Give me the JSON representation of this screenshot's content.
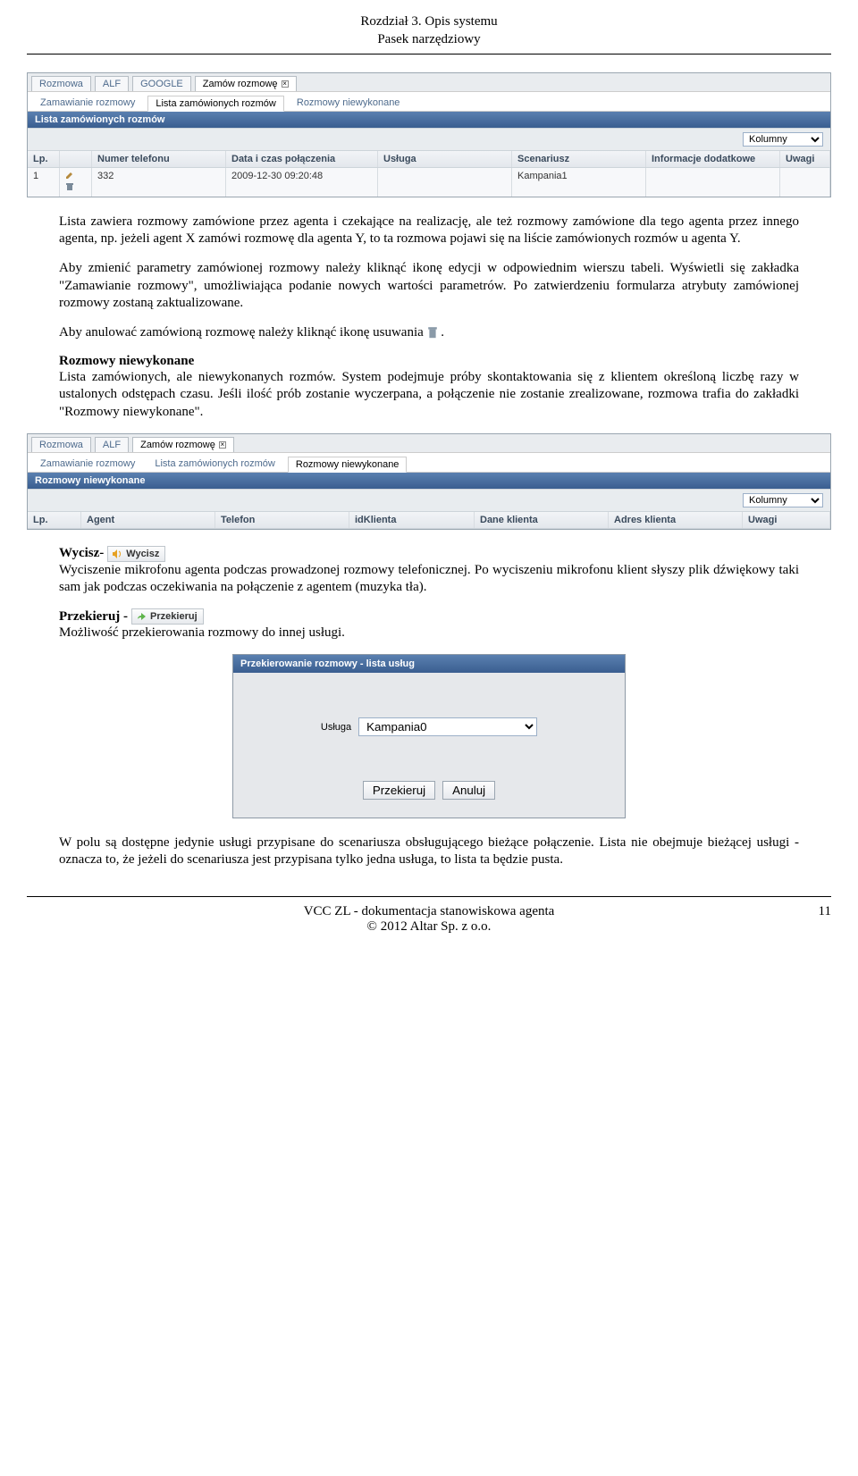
{
  "header": {
    "line1": "Rozdział 3. Opis systemu",
    "line2": "Pasek narzędziowy"
  },
  "shot1": {
    "tabs": [
      "Rozmowa",
      "ALF",
      "GOOGLE",
      "Zamów rozmowę"
    ],
    "subtabs": [
      "Zamawianie rozmowy",
      "Lista zamówionych rozmów",
      "Rozmowy niewykonane"
    ],
    "panel": "Lista zamówionych rozmów",
    "kolumny": "Kolumny",
    "cols": [
      "Lp.",
      "Numer telefonu",
      "Data i czas połączenia",
      "Usługa",
      "Scenariusz",
      "Informacje dodatkowe",
      "Uwagi"
    ],
    "row": {
      "lp": "1",
      "num": "332",
      "date": "2009-12-30 09:20:48",
      "scen": "Kampania1"
    }
  },
  "p1": "Lista zawiera rozmowy zamówione przez agenta i czekające na realizację, ale też rozmowy zamówione dla tego agenta przez innego agenta, np. jeżeli agent X zamówi rozmowę dla agenta Y, to ta rozmowa pojawi się na liście zamówionych rozmów u agenta Y.",
  "p2": "Aby zmienić parametry zamówionej rozmowy należy kliknąć ikonę edycji w odpowiednim wierszu tabeli. Wyświetli się zakładka \"Zamawianie rozmowy\", umożliwiająca podanie nowych wartości parametrów. Po zatwierdzeniu formularza atrybuty zamówionej rozmowy zostaną zaktualizowane.",
  "p3a": "Aby anulować zamówioną rozmowę należy kliknąć ikonę usuwania ",
  "p3b": " .",
  "rozmowy_h": "Rozmowy niewykonane",
  "p4": "Lista zamówionych, ale niewykonanych rozmów. System podejmuje próby skontaktowania się z klientem określoną liczbę razy w ustalonych odstępach czasu. Jeśli ilość prób zostanie wyczerpana, a połączenie nie zostanie zrealizowane, rozmowa trafia do zakładki \"Rozmowy niewykonane\".",
  "shot2": {
    "tabs": [
      "Rozmowa",
      "ALF",
      "Zamów rozmowę"
    ],
    "subtabs": [
      "Zamawianie rozmowy",
      "Lista zamówionych rozmów",
      "Rozmowy niewykonane"
    ],
    "panel": "Rozmowy niewykonane",
    "kolumny": "Kolumny",
    "cols": [
      "Lp.",
      "Agent",
      "Telefon",
      "idKlienta",
      "Dane klienta",
      "Adres klienta",
      "Uwagi"
    ]
  },
  "wycisz_term": "Wycisz-",
  "wycisz_btn": "Wycisz",
  "p5": "Wyciszenie mikrofonu agenta podczas prowadzonej rozmowy telefonicznej. Po wyciszeniu mikrofonu klient słyszy plik dźwiękowy taki sam jak podczas oczekiwania na połączenie z agentem (muzyka tła).",
  "przekieruj_term": "Przekieruj - ",
  "przekieruj_btn": "Przekieruj",
  "p6": "Możliwość przekierowania rozmowy do innej usługi.",
  "dialog": {
    "title": "Przekierowanie rozmowy - lista usług",
    "label": "Usługa",
    "value": "Kampania0",
    "ok": "Przekieruj",
    "cancel": "Anuluj"
  },
  "p7": "W polu są dostępne jedynie usługi przypisane do scenariusza obsługującego bieżące połączenie. Lista nie obejmuje bieżącej usługi - oznacza to, że jeżeli do scenariusza jest przypisana tylko jedna usługa, to lista ta będzie pusta.",
  "footer": {
    "line1": "VCC ZL - dokumentacja stanowiskowa agenta",
    "line2": "© 2012 Altar Sp. z o.o.",
    "page": "11"
  }
}
